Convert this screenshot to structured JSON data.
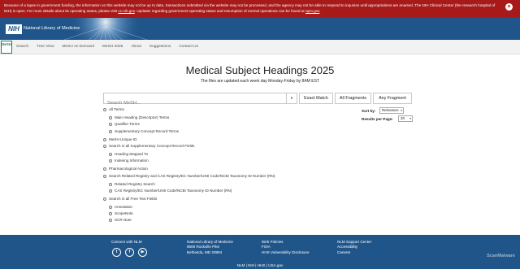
{
  "alert": {
    "text_before_link1": "Because of a lapse in government funding, the information on this website may not be up to date, transactions submitted via the website may not be processed, and the agency may not be able to respond to inquiries until appropriations are enacted. The NIH Clinical Center (the research hospital of NIH) is open. For more details about its operating status, please visit ",
    "link1": "cc.nih.gov",
    "text_between": ". Updates regarding government operating status and resumption of normal operations can be found at ",
    "link2": "opm.gov",
    "text_after": ".",
    "close_icon": "close-x-icon"
  },
  "nih": {
    "logo_text": "NIH",
    "name": "National Library of Medicine"
  },
  "mesh_logo": "MeSH",
  "nav": [
    "Search",
    "Tree View",
    "MeSH on Demand",
    "MeSH 2026",
    "About",
    "Suggestions",
    "Contact Us"
  ],
  "page": {
    "title": "Medical Subject Headings 2025",
    "subtitle": "The files are updated each week day Monday-Friday by 8AM EST"
  },
  "search": {
    "placeholder": "Search MeSH...",
    "dropdown_icon": "caret-down-icon",
    "buttons": [
      "Exact Match",
      "All Fragments",
      "Any Fragment"
    ]
  },
  "options": [
    {
      "label": "All Terms",
      "level": 0
    },
    {
      "label": "Main Heading (Descriptor) Terms",
      "level": 1
    },
    {
      "label": "Qualifier Terms",
      "level": 1
    },
    {
      "label": "Supplementary Concept Record Terms",
      "level": 1
    },
    {
      "label": "MeSH Unique ID",
      "level": 0
    },
    {
      "label": "Search in all Supplementary Concept Record Fields",
      "level": 0
    },
    {
      "label": "Heading Mapped To",
      "level": 1
    },
    {
      "label": "Indexing Information",
      "level": 1
    },
    {
      "label": "Pharmacological Action",
      "level": 0
    },
    {
      "label": "Search Related Registry and CAS Registry/EC Number/UNII Code/NCBI Taxonomy ID Number (RN)",
      "level": 0
    },
    {
      "label": "Related Registry Search",
      "level": 1
    },
    {
      "label": "CAS Registry/EC Number/UNII Code/NCBI Taxonomy ID Number (RN)",
      "level": 1
    },
    {
      "label": "Search in all Free Text Fields",
      "level": 0
    },
    {
      "label": "Annotation",
      "level": 1
    },
    {
      "label": "ScopeNote",
      "level": 1
    },
    {
      "label": "SCR Note",
      "level": 1
    }
  ],
  "sort": {
    "sort_label": "Sort by:",
    "sort_value": "Relevance",
    "results_label": "Results per Page:",
    "results_value": "20"
  },
  "footer": {
    "connect": "Connect with NLM",
    "social_icons": [
      "twitter-icon",
      "facebook-icon",
      "youtube-icon"
    ],
    "address": [
      "National Library of Medicine",
      "8600 Rockville Pike",
      "Bethesda, MD 20894"
    ],
    "policies": [
      "Web Policies",
      "FOIA",
      "HHS Vulnerability Disclosure"
    ],
    "support": [
      "NLM Support Center",
      "Accessibility",
      "Careers"
    ],
    "bottom": "NLM | NIH | HHS | USA.gov"
  },
  "watermark": "ScanMalware"
}
